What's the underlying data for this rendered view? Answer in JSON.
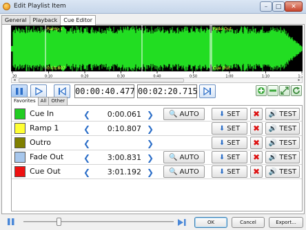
{
  "window": {
    "title": "Edit Playlist Item",
    "min": "–",
    "max": "□",
    "close": "✕"
  },
  "tabs": [
    {
      "label": "General"
    },
    {
      "label": "Playback"
    },
    {
      "label": "Cue Editor"
    }
  ],
  "waveform": {
    "markers": [
      {
        "label": "Ramp 1"
      },
      {
        "label": "0:10.807"
      },
      {
        "label": "Fade Out"
      },
      {
        "label": "Cue Out"
      }
    ],
    "ruler": [
      "20",
      "0:10",
      "0:20",
      "0:30",
      "0:40",
      "0:50",
      "1:00",
      "1:10",
      "1:20"
    ]
  },
  "transport": {
    "position": "00:00:40.477",
    "duration": "00:02:20.715"
  },
  "inner_tabs": [
    {
      "label": "Favorites"
    },
    {
      "label": "All"
    },
    {
      "label": "Other"
    }
  ],
  "cues": [
    {
      "name": "Cue In",
      "time": "0:00.061",
      "color": "#22cc22",
      "auto": true,
      "auto_label": "AUTO",
      "set_label": "SET",
      "test_label": "TEST"
    },
    {
      "name": "Ramp 1",
      "time": "0:10.807",
      "color": "#ffff33",
      "auto": false,
      "auto_label": "AUTO",
      "set_label": "SET",
      "test_label": "TEST"
    },
    {
      "name": "Outro",
      "time": "",
      "color": "#808000",
      "auto": false,
      "auto_label": "AUTO",
      "set_label": "SET",
      "test_label": "TEST"
    },
    {
      "name": "Fade Out",
      "time": "3:00.831",
      "color": "#a7c7ec",
      "auto": true,
      "auto_label": "AUTO",
      "set_label": "SET",
      "test_label": "TEST"
    },
    {
      "name": "Cue Out",
      "time": "3:01.192",
      "color": "#ee1111",
      "auto": true,
      "auto_label": "AUTO",
      "set_label": "SET",
      "test_label": "TEST"
    }
  ],
  "footer": {
    "ok": "OK",
    "cancel": "Cancel",
    "export": "Export..."
  },
  "colors": {
    "wave": "#22dd22",
    "accent": "#2d6fc8",
    "marker_text": "#ffff44"
  }
}
